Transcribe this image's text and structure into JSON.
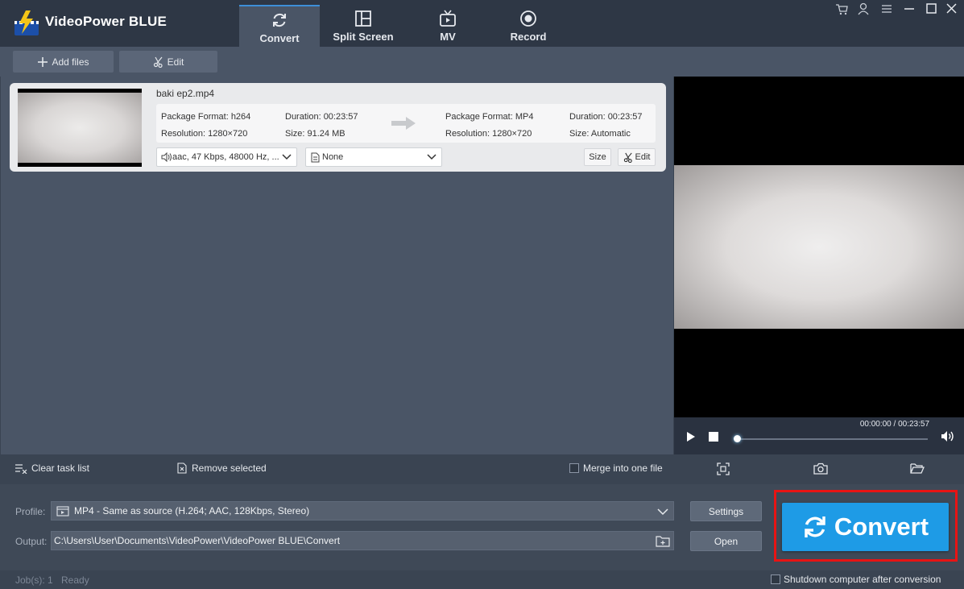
{
  "app": {
    "title": "VideoPower BLUE"
  },
  "tabs": [
    {
      "label": "Convert",
      "icon": "refresh-icon",
      "active": true
    },
    {
      "label": "Split Screen",
      "icon": "split-screen-icon",
      "active": false
    },
    {
      "label": "MV",
      "icon": "tv-icon",
      "active": false
    },
    {
      "label": "Record",
      "icon": "record-icon",
      "active": false
    }
  ],
  "toolbar": {
    "add_files": "Add files",
    "edit": "Edit"
  },
  "task": {
    "file_name": "baki ep2.mp4",
    "source": {
      "format": "Package Format: h264",
      "resolution": "Resolution: 1280×720",
      "duration": "Duration: 00:23:57",
      "size": "Size: 91.24 MB"
    },
    "target": {
      "format": "Package Format: MP4",
      "resolution": "Resolution: 1280×720",
      "duration": "Duration: 00:23:57",
      "size": "Size: Automatic"
    },
    "audio_track": "aac, 47 Kbps, 48000 Hz, ...",
    "subtitle": "None",
    "size_btn": "Size",
    "edit_btn": "Edit"
  },
  "preview": {
    "time": "00:00:00 / 00:23:57",
    "progress": 0
  },
  "listbar": {
    "clear": "Clear task list",
    "remove": "Remove selected",
    "merge": "Merge into one file"
  },
  "settings": {
    "profile_label": "Profile:",
    "profile_value": "MP4 - Same as source (H.264; AAC, 128Kbps, Stereo)",
    "output_label": "Output:",
    "output_value": "C:\\Users\\User\\Documents\\VideoPower\\VideoPower BLUE\\Convert",
    "settings_btn": "Settings",
    "open_btn": "Open",
    "convert_btn": "Convert"
  },
  "status": {
    "jobs": "Job(s): 1",
    "state": "Ready",
    "shutdown": "Shutdown computer after conversion"
  },
  "colors": {
    "accent": "#1e9be6",
    "highlight": "#e81414"
  }
}
